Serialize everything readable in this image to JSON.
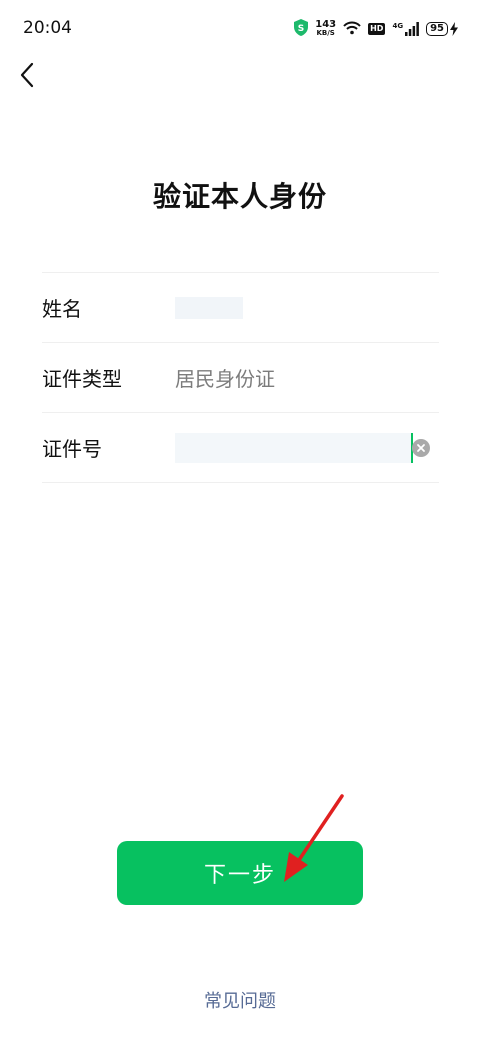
{
  "status_bar": {
    "time": "20:04",
    "net_speed_value": "143",
    "net_speed_unit": "KB/S",
    "hd_label": "HD",
    "network_gen": "4G",
    "battery_level": "95",
    "icons": [
      "security-shield-icon",
      "wifi-icon",
      "hd-icon",
      "signal-icon",
      "battery-icon",
      "charging-icon"
    ]
  },
  "nav": {
    "back_icon": "chevron-left-icon"
  },
  "page": {
    "title": "验证本人身份"
  },
  "form": {
    "name_label": "姓名",
    "name_value": "",
    "id_type_label": "证件类型",
    "id_type_value": "居民身份证",
    "id_number_label": "证件号",
    "id_number_value": ""
  },
  "actions": {
    "next_label": "下一步",
    "faq_label": "常见问题"
  },
  "colors": {
    "primary_green": "#07c160",
    "link_blue": "#576b95",
    "annotation_red": "#e02020"
  }
}
